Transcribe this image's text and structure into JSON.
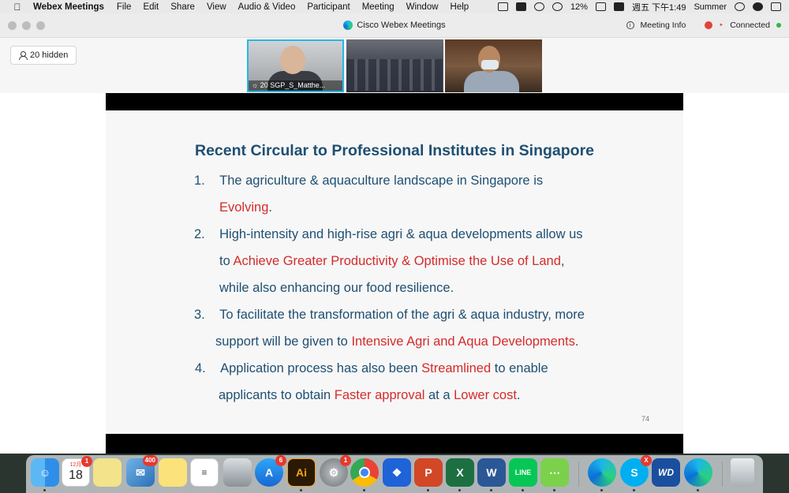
{
  "menubar": {
    "app_name": "Webex Meetings",
    "items": [
      "File",
      "Edit",
      "Share",
      "View",
      "Audio & Video",
      "Participant",
      "Meeting",
      "Window",
      "Help"
    ],
    "battery": "12%",
    "clock": "週五 下午1:49",
    "user": "Summer"
  },
  "window": {
    "title": "Cisco Webex Meetings",
    "meeting_info": "Meeting Info",
    "connection_status": "Connected",
    "hidden_participants": "20 hidden"
  },
  "participants": [
    {
      "label": "20 SGP_S_Matthe..."
    }
  ],
  "slide": {
    "title": "Recent Circular to Professional Institutes in Singapore",
    "lines": [
      {
        "num": "1.",
        "parts": [
          "The agriculture & aquaculture landscape in Singapore is"
        ]
      },
      {
        "num": "",
        "highlight": "Evolving",
        "after": "."
      },
      {
        "num": "2.",
        "parts": [
          "High-intensity and high-rise agri & aqua developments allow us"
        ]
      },
      {
        "num": "",
        "before": "to ",
        "highlight": "Achieve Greater Productivity & Optimise the Use of Land",
        "after": ","
      },
      {
        "num": "",
        "parts": [
          "while also enhancing our food resilience."
        ]
      },
      {
        "num": "3.",
        "parts": [
          "To facilitate the transformation of the agri & aqua industry, more"
        ]
      },
      {
        "num": "",
        "before": "support will be given to ",
        "highlight": "Intensive Agri and Aqua Developments",
        "after": "."
      },
      {
        "num": "4.",
        "before": "Application process has also been ",
        "highlight": "Streamlined",
        "after": " to enable"
      },
      {
        "num": "",
        "before": "applicants to obtain ",
        "highlight": "Faster approval",
        "middle": " at a ",
        "highlight2": "Lower cost",
        "after": "."
      }
    ],
    "page_number": "74"
  },
  "dock": {
    "calendar_month": "12月",
    "calendar_day": "18",
    "badges": {
      "calendar": "1",
      "mail": "400",
      "appstore": "6",
      "sysprefs": "1",
      "skype": "X"
    },
    "illustrator_label": "Ai",
    "colors": {
      "finder": "#2f8fe8",
      "illustrator": "#2a1a05",
      "dropbox": "#1f63d8",
      "powerpoint": "#d24726",
      "excel": "#1d6f42",
      "word": "#2b5797",
      "line": "#06c755",
      "wechat": "#7bd14a",
      "wd": "#1a4fa0"
    }
  }
}
